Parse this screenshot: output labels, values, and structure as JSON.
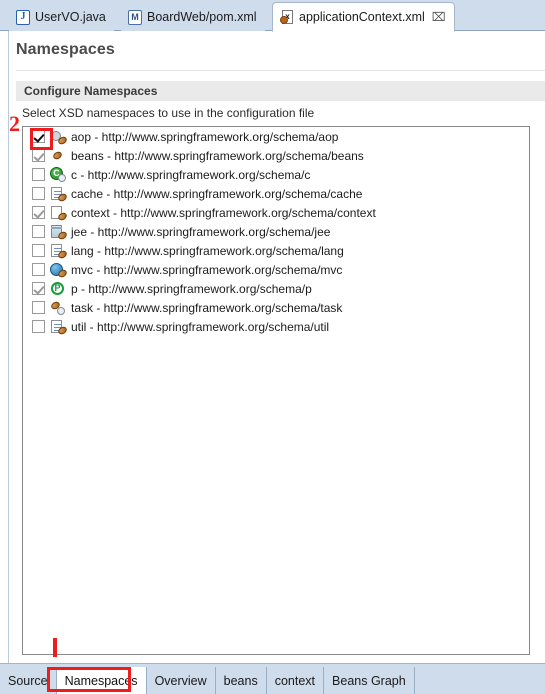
{
  "editor_tabs": [
    {
      "label": "UserVO.java",
      "icon": "java-file-icon",
      "active": false,
      "closable": false
    },
    {
      "label": "BoardWeb/pom.xml",
      "icon": "maven-pom-icon",
      "active": false,
      "closable": false
    },
    {
      "label": "applicationContext.xml",
      "icon": "spring-xml-icon",
      "active": true,
      "closable": true,
      "close_glyph": "⌧"
    }
  ],
  "form": {
    "title": "Namespaces",
    "section_title": "Configure Namespaces",
    "section_description": "Select XSD namespaces to use in the configuration file"
  },
  "namespaces": [
    {
      "checked": true,
      "focused": true,
      "prefix": "aop",
      "sep": "-",
      "uri": "http://www.springframework.org/schema/aop",
      "icon": "aop-schema-icon"
    },
    {
      "checked": true,
      "focused": false,
      "prefix": "beans",
      "sep": "-",
      "uri": "http://www.springframework.org/schema/beans",
      "icon": "beans-schema-icon"
    },
    {
      "checked": false,
      "focused": false,
      "prefix": "c",
      "sep": "-",
      "uri": "http://www.springframework.org/schema/c",
      "icon": "c-namespace-icon"
    },
    {
      "checked": false,
      "focused": false,
      "prefix": "cache",
      "sep": "-",
      "uri": "http://www.springframework.org/schema/cache",
      "icon": "cache-schema-icon"
    },
    {
      "checked": true,
      "focused": false,
      "prefix": "context",
      "sep": "-",
      "uri": "http://www.springframework.org/schema/context",
      "icon": "context-schema-icon"
    },
    {
      "checked": false,
      "focused": false,
      "prefix": "jee",
      "sep": "-",
      "uri": "http://www.springframework.org/schema/jee",
      "icon": "jee-schema-icon"
    },
    {
      "checked": false,
      "focused": false,
      "prefix": "lang",
      "sep": "-",
      "uri": "http://www.springframework.org/schema/lang",
      "icon": "lang-schema-icon"
    },
    {
      "checked": false,
      "focused": false,
      "prefix": "mvc",
      "sep": "-",
      "uri": "http://www.springframework.org/schema/mvc",
      "icon": "mvc-schema-icon"
    },
    {
      "checked": true,
      "focused": false,
      "prefix": "p",
      "sep": "-",
      "uri": "http://www.springframework.org/schema/p",
      "icon": "p-namespace-icon"
    },
    {
      "checked": false,
      "focused": false,
      "prefix": "task",
      "sep": "-",
      "uri": "http://www.springframework.org/schema/task",
      "icon": "task-schema-icon"
    },
    {
      "checked": false,
      "focused": false,
      "prefix": "util",
      "sep": "-",
      "uri": "http://www.springframework.org/schema/util",
      "icon": "util-schema-icon"
    }
  ],
  "page_tabs": [
    {
      "label": "Source",
      "active": false
    },
    {
      "label": "Namespaces",
      "active": true
    },
    {
      "label": "Overview",
      "active": false
    },
    {
      "label": "beans",
      "active": false
    },
    {
      "label": "context",
      "active": false
    },
    {
      "label": "Beans Graph",
      "active": false
    }
  ],
  "annotations": [
    {
      "id": "step-2-label",
      "text": "2",
      "color": "#ee1c1c"
    }
  ],
  "colors": {
    "annotation_red": "#ee1c1c",
    "tab_strip": "#cfdcec",
    "section_header": "#eaeaea",
    "title_text": "#4b4b4b"
  }
}
